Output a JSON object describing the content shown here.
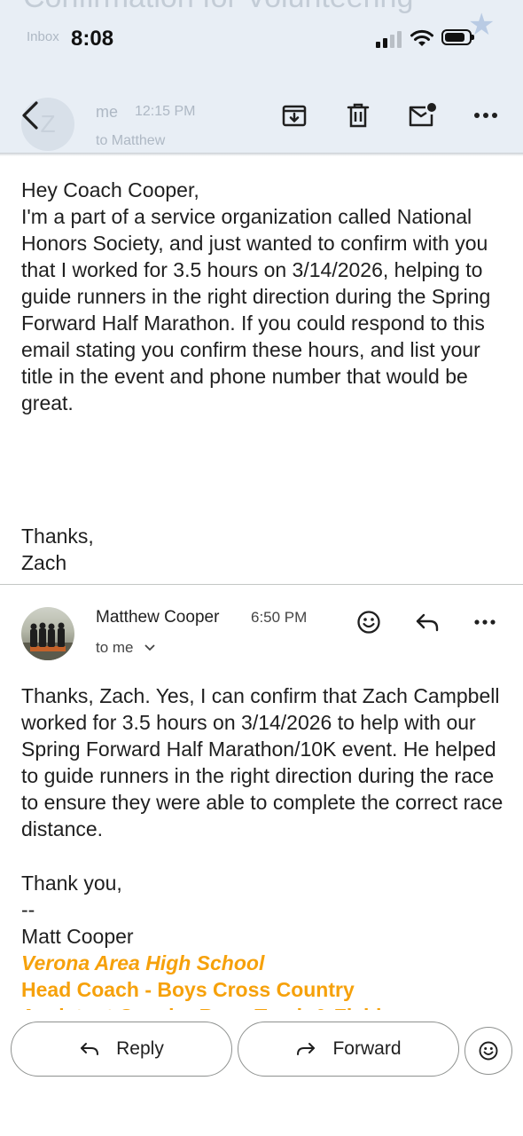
{
  "status_bar": {
    "time": "8:08"
  },
  "background_ghost": {
    "subject": "Confirmation for Volunteering",
    "inbox_label": "Inbox",
    "avatar_letter": "Z",
    "sender": "me",
    "time": "12:15 PM",
    "to": "to Matthew"
  },
  "toolbar": {
    "back_icon": "back-arrow-icon",
    "archive_icon": "archive-icon",
    "delete_icon": "trash-icon",
    "mark_unread_icon": "mark-unread-icon",
    "more_icon": "more-horizontal-icon"
  },
  "message1": {
    "greeting": "Hey Coach Cooper,",
    "body": "I'm a part of a service organization called National Honors Society, and just wanted to confirm with you that I worked for 3.5 hours on 3/14/2026, helping to guide runners in the right direction during the Spring Forward Half Marathon. If you could respond to this email stating you confirm these hours, and list your title in the event and phone number that would be great.",
    "closing": "Thanks,",
    "name": "Zach"
  },
  "message2": {
    "sender": "Matthew Cooper",
    "time": "6:50 PM",
    "to": "to me",
    "body": "Thanks, Zach. Yes, I can confirm that Zach Campbell worked for 3.5 hours on 3/14/2026 to help with our Spring Forward Half Marathon/10K event. He helped to guide runners in the right direction during the race to ensure they were able to complete the correct race distance.",
    "closing": "Thank you,",
    "dashes": "--",
    "signature_name": "Matt Cooper",
    "school": "Verona Area High School",
    "title1": "Head Coach - Boys Cross Country",
    "title2_partial": "Assistant Coach - Boys Track & Field"
  },
  "actions": {
    "reply": "Reply",
    "forward": "Forward"
  },
  "colors": {
    "accent_orange": "#f6a10b",
    "toolbar_bg": "#e8eef5"
  }
}
